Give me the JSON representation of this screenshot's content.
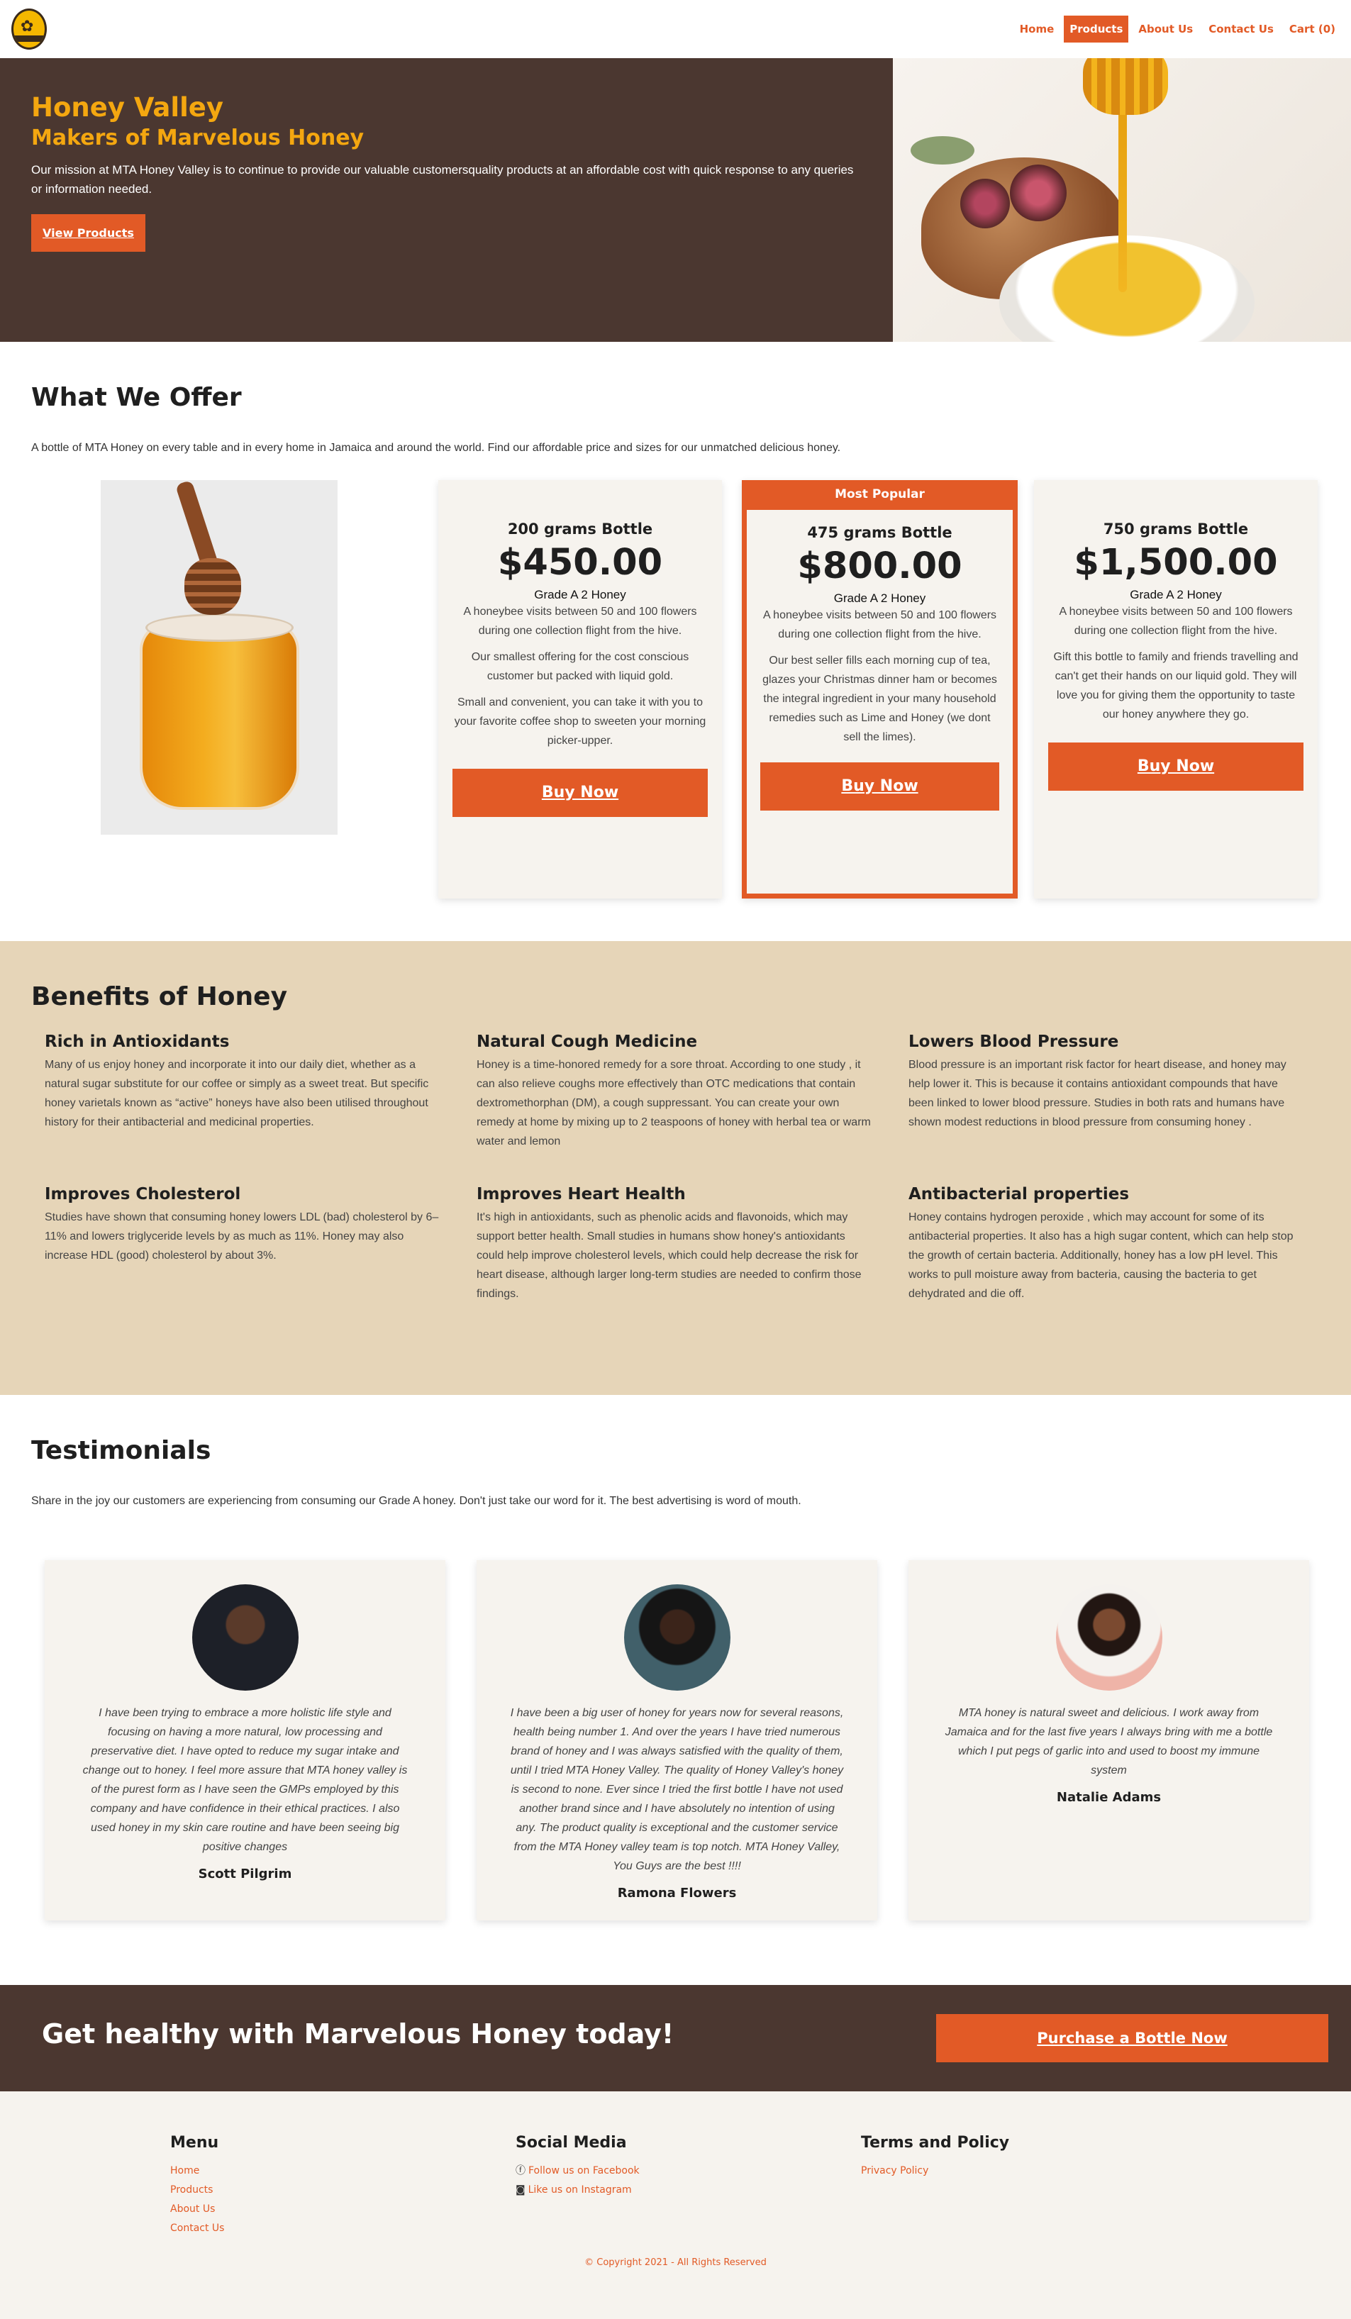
{
  "nav": {
    "links": [
      "Home",
      "Products",
      "About Us",
      "Contact Us",
      "Cart (0)"
    ]
  },
  "hero": {
    "title": "Honey Valley",
    "subtitle": "Makers of Marvelous Honey",
    "mission": "Our mission at MTA Honey Valley is to continue to provide our valuable customersquality products at an affordable cost with quick response to any queries or information needed.",
    "button": "View Products"
  },
  "offer": {
    "title": "What We Offer",
    "lead": "A bottle of MTA Honey on every table and in every home in Jamaica and around the world. Find our affordable price and sizes for our unmatched delicious honey.",
    "cards": [
      {
        "title": "200 grams Bottle",
        "price": "$450.00",
        "grade": "Grade A 2 Honey",
        "texts": [
          "A honeybee visits between 50 and 100 flowers during one collection flight from the hive.",
          "Our smallest offering for the cost conscious customer but packed with liquid gold.",
          "Small and convenient, you can take it with you to your favorite coffee shop to sweeten your morning picker-upper."
        ],
        "button": "Buy Now"
      },
      {
        "badge": "Most Popular",
        "title": "475 grams Bottle",
        "price": "$800.00",
        "grade": "Grade A 2 Honey",
        "texts": [
          "A honeybee visits between 50 and 100 flowers during one collection flight from the hive.",
          "Our best seller fills each morning cup of tea, glazes your Christmas dinner ham or becomes the integral ingredient in your many household remedies such as Lime and Honey (we dont sell the limes)."
        ],
        "button": "Buy Now"
      },
      {
        "title": "750 grams Bottle",
        "price": "$1,500.00",
        "grade": "Grade A 2 Honey",
        "texts": [
          "A honeybee visits between 50 and 100 flowers during one collection flight from the hive.",
          "Gift this bottle to family and friends travelling and can't get their hands on our liquid gold. They will love you for giving them the opportunity to taste our honey anywhere they go."
        ],
        "button": "Buy Now"
      }
    ]
  },
  "benefits": {
    "title": "Benefits of Honey",
    "items": [
      {
        "title": "Rich in Antioxidants",
        "text": "Many of us enjoy honey and incorporate it into our daily diet, whether as a natural sugar substitute for our coffee or simply as a sweet treat. But specific honey varietals known as “active” honeys have also been utilised throughout history for their antibacterial and medicinal properties."
      },
      {
        "title": "Natural Cough Medicine",
        "text": "Honey is a time-honored remedy for a sore throat. According to one study , it can also relieve coughs more effectively than OTC medications that contain dextromethorphan (DM), a cough suppressant. You can create your own remedy at home by mixing up to 2 teaspoons of honey with herbal tea or warm water and lemon"
      },
      {
        "title": "Lowers Blood Pressure",
        "text": "Blood pressure is an important risk factor for heart disease, and honey may help lower it. This is because it contains antioxidant compounds that have been linked to lower blood pressure. Studies in both rats and humans have shown modest reductions in blood pressure from consuming honey ."
      },
      {
        "title": "Improves Cholesterol",
        "text": "Studies have shown that consuming honey lowers LDL (bad) cholesterol by 6–11% and lowers triglyceride levels by as much as 11%. Honey may also increase HDL (good) cholesterol by about 3%."
      },
      {
        "title": "Improves Heart Health",
        "text": "It's high in antioxidants, such as phenolic acids and flavonoids, which may support better health. Small studies in humans show honey's antioxidants could help improve cholesterol levels, which could help decrease the risk for heart disease, although larger long-term studies are needed to confirm those findings."
      },
      {
        "title": "Antibacterial properties",
        "text": "Honey contains hydrogen peroxide , which may account for some of its antibacterial properties. It also has a high sugar content, which can help stop the growth of certain bacteria. Additionally, honey has a low pH level. This works to pull moisture away from bacteria, causing the bacteria to get dehydrated and die off."
      }
    ]
  },
  "testimonials": {
    "title": "Testimonials",
    "lead": "Share in the joy our customers are experiencing from consuming our Grade A honey. Don't just take our word for it. The best advertising is word of mouth.",
    "items": [
      {
        "quote": "I have been trying to embrace a more holistic life style and focusing on having a more natural, low processing and preservative diet. I have opted to reduce my sugar intake and change out to honey. I feel more assure that MTA honey valley is of the purest form as I have seen the GMPs employed by this company and have confidence in their ethical practices. I also used honey in my skin care routine and have been seeing big positive changes",
        "name": "Scott Pilgrim"
      },
      {
        "quote": "I have been a big user of honey for years now for several reasons, health being number 1. And over the years I have tried numerous brand of honey and I was always satisfied with the quality of them, until I tried MTA Honey Valley. The quality of Honey Valley's honey is second to none. Ever since I tried the first bottle I have not used another brand since and I have absolutely no intention of using any. The product quality is exceptional and the customer service from the MTA Honey valley team is top notch. MTA Honey Valley, You Guys are the best !!!!",
        "name": "Ramona Flowers"
      },
      {
        "quote": "MTA honey is natural sweet and delicious. I work away from Jamaica and for the last five years I always bring with me a bottle which I put pegs of garlic into and used to boost my immune system",
        "name": "Natalie Adams"
      }
    ]
  },
  "cta": {
    "title": "Get healthy with Marvelous Honey today!",
    "button": "Purchase a Bottle Now"
  },
  "footer": {
    "menu_title": "Menu",
    "menu": [
      "Home",
      "Products",
      "About Us",
      "Contact Us"
    ],
    "social_title": "Social Media",
    "social": [
      "Follow us on Facebook",
      "Like us on Instagram"
    ],
    "terms_title": "Terms and Policy",
    "terms": [
      "Privacy Policy"
    ],
    "copyright": "© Copyright 2021 - All Rights Reserved"
  },
  "colors": {
    "accent": "#e25a26",
    "brown": "#4b3730",
    "gold": "#f4a710",
    "sand": "#e6d5b8",
    "card": "#f6f3ee"
  }
}
